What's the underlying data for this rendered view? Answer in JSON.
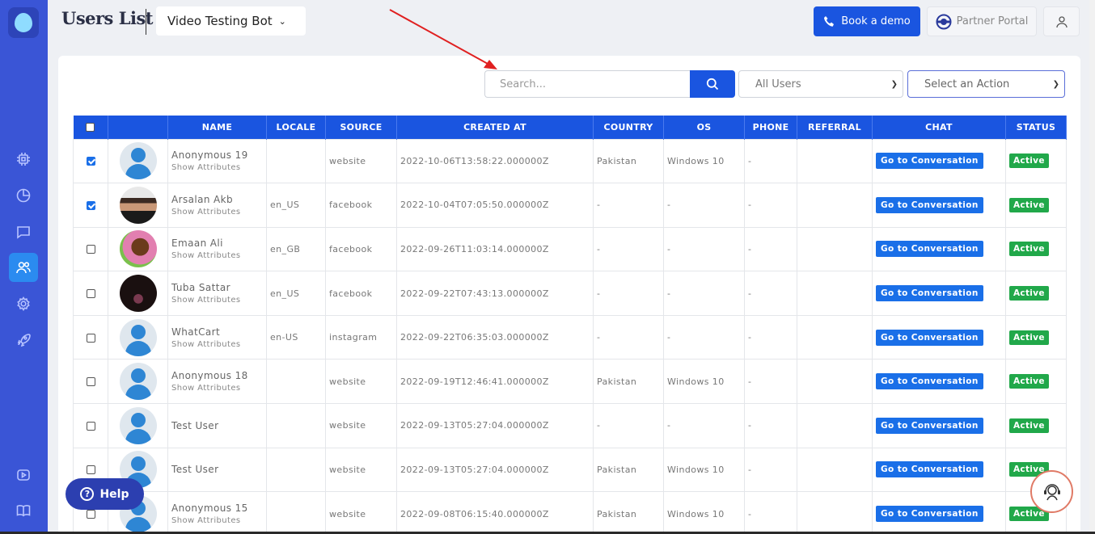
{
  "header": {
    "title": "Users List",
    "bot_name": "Video Testing Bot",
    "book_demo": "Book a demo",
    "partner_portal": "Partner Portal"
  },
  "filters": {
    "search_placeholder": "Search...",
    "users_filter": "All Users",
    "action_select": "Select an Action"
  },
  "table": {
    "columns": [
      "NAME",
      "LOCALE",
      "SOURCE",
      "CREATED AT",
      "COUNTRY",
      "OS",
      "PHONE",
      "REFERRAL",
      "CHAT",
      "STATUS"
    ],
    "rows": [
      {
        "checked": true,
        "avatar": "default",
        "name": "Anonymous 19",
        "sub": "Show Attributes",
        "locale": "",
        "source": "website",
        "created": "2022-10-06T13:58:22.000000Z",
        "country": "Pakistan",
        "os": "Windows 10",
        "phone": "-",
        "referral": "",
        "chat": "Go to Conversation",
        "status": "Active"
      },
      {
        "checked": true,
        "avatar": "arsalan",
        "name": "Arsalan Akb",
        "sub": "Show Attributes",
        "locale": "en_US",
        "source": "facebook",
        "created": "2022-10-04T07:05:50.000000Z",
        "country": "-",
        "os": "-",
        "phone": "-",
        "referral": "",
        "chat": "Go to Conversation",
        "status": "Active"
      },
      {
        "checked": false,
        "avatar": "emaan",
        "name": "Emaan Ali",
        "sub": "Show Attributes",
        "locale": "en_GB",
        "source": "facebook",
        "created": "2022-09-26T11:03:14.000000Z",
        "country": "-",
        "os": "-",
        "phone": "-",
        "referral": "",
        "chat": "Go to Conversation",
        "status": "Active"
      },
      {
        "checked": false,
        "avatar": "tuba",
        "name": "Tuba Sattar",
        "sub": "Show Attributes",
        "locale": "en_US",
        "source": "facebook",
        "created": "2022-09-22T07:43:13.000000Z",
        "country": "-",
        "os": "-",
        "phone": "-",
        "referral": "",
        "chat": "Go to Conversation",
        "status": "Active"
      },
      {
        "checked": false,
        "avatar": "default",
        "name": "WhatCart",
        "sub": "Show Attributes",
        "locale": "en-US",
        "source": "instagram",
        "created": "2022-09-22T06:35:03.000000Z",
        "country": "-",
        "os": "-",
        "phone": "-",
        "referral": "",
        "chat": "Go to Conversation",
        "status": "Active"
      },
      {
        "checked": false,
        "avatar": "default",
        "name": "Anonymous 18",
        "sub": "Show Attributes",
        "locale": "",
        "source": "website",
        "created": "2022-09-19T12:46:41.000000Z",
        "country": "Pakistan",
        "os": "Windows 10",
        "phone": "-",
        "referral": "",
        "chat": "Go to Conversation",
        "status": "Active"
      },
      {
        "checked": false,
        "avatar": "default",
        "name": "Test User",
        "sub": "",
        "locale": "",
        "source": "website",
        "created": "2022-09-13T05:27:04.000000Z",
        "country": "-",
        "os": "-",
        "phone": "-",
        "referral": "",
        "chat": "Go to Conversation",
        "status": "Active"
      },
      {
        "checked": false,
        "avatar": "default",
        "name": "Test User",
        "sub": "",
        "locale": "",
        "source": "website",
        "created": "2022-09-13T05:27:04.000000Z",
        "country": "Pakistan",
        "os": "Windows 10",
        "phone": "-",
        "referral": "",
        "chat": "Go to Conversation",
        "status": "Active"
      },
      {
        "checked": false,
        "avatar": "default",
        "name": "Anonymous 15",
        "sub": "Show Attributes",
        "locale": "",
        "source": "website",
        "created": "2022-09-08T06:15:40.000000Z",
        "country": "Pakistan",
        "os": "Windows 10",
        "phone": "-",
        "referral": "",
        "chat": "Go to Conversation",
        "status": "Active"
      }
    ]
  },
  "help": {
    "label": "Help"
  },
  "colors": {
    "primary": "#1a55e0",
    "sidebar": "#3a55d6",
    "success": "#21a84a",
    "annotation": "#e02020"
  }
}
